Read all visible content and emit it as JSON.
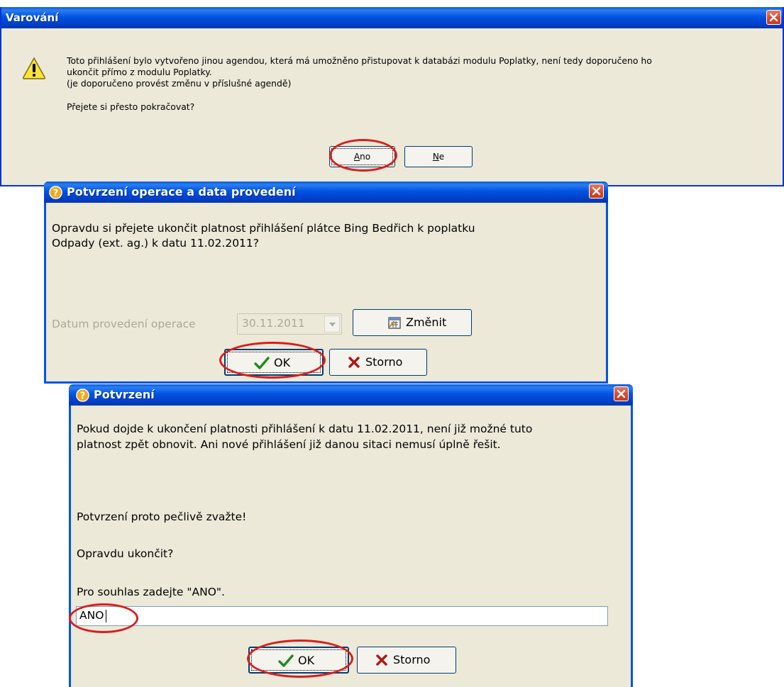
{
  "warning_dialog": {
    "title": "Varování",
    "message_line1": "Toto přihlášení bylo vytvořeno jinou agendou, která má umožněno přistupovat k databázi modulu Poplatky, není tedy doporučeno ho",
    "message_line2": "ukončit přímo z modulu Poplatky.",
    "message_line3": "(je doporučeno provést změnu v příslušné agendě)",
    "question": "Přejete si přesto pokračovat?",
    "yes_button": {
      "first": "A",
      "rest": "no"
    },
    "no_button": {
      "first": "N",
      "rest": "e"
    }
  },
  "confirm_dialog": {
    "title": "Potvrzení operace a data provedení",
    "message_line1": "Opravdu si přejete ukončit platnost přihlášení plátce Bing Bedřich k poplatku",
    "message_line2": "Odpady (ext. ag.) k datu 11.02.2011?",
    "date_label": "Datum provedení operace",
    "date_value": "30.11.2011",
    "change_button": "Změnit",
    "ok_button": "OK",
    "cancel_button": "Storno"
  },
  "final_dialog": {
    "title": "Potvrzení",
    "message_line1": "Pokud dojde k ukončení platnosti přihlášení k datu 11.02.2011, není již možné tuto",
    "message_line2": "platnost zpět obnovit. Ani nové přihlášení již danou sitaci nemusí úplně řešit.",
    "warning_text": "Potvrzení proto pečlivě zvažte!",
    "question": "Opravdu ukončit?",
    "prompt": "Pro souhlas zadejte \"ANO\".",
    "input_value": "ANO",
    "ok_button": "OK",
    "cancel_button": "Storno"
  },
  "colors": {
    "dialog_bg": "#ece9d8",
    "titlebar": "#0054e3",
    "highlight_ring": "#d81e1e"
  },
  "icons": {
    "warning": "warning-icon",
    "question": "question-icon",
    "close": "close-icon",
    "check": "check-icon",
    "cross": "cross-icon",
    "calendar": "calendar-icon",
    "dropdown": "chevron-down-icon"
  }
}
